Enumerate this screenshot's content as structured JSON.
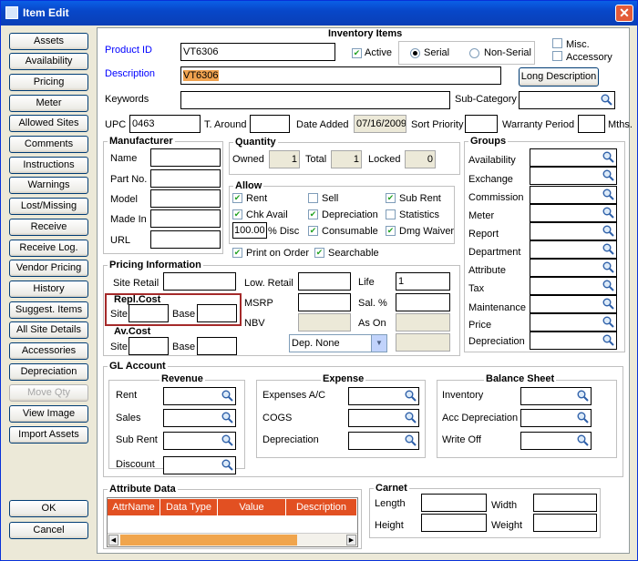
{
  "window": {
    "title": "Item Edit"
  },
  "sidebar": {
    "buttons": [
      "Assets",
      "Availability",
      "Pricing",
      "Meter",
      "Allowed Sites",
      "Comments",
      "Instructions",
      "Warnings",
      "Lost/Missing",
      "Receive",
      "Receive Log.",
      "Vendor Pricing",
      "History",
      "Suggest. Items",
      "All Site Details",
      "Accessories",
      "Depreciation",
      "Move Qty",
      "View Image",
      "Import Assets"
    ],
    "ok": "OK",
    "cancel": "Cancel"
  },
  "inventory": {
    "title": "Inventory Items",
    "product_id_label": "Product ID",
    "product_id": "VT6306",
    "active_label": "Active",
    "serial_label": "Serial",
    "non_serial_label": "Non-Serial",
    "misc_label": "Misc.",
    "accessory_label": "Accessory",
    "description_label": "Description",
    "description": "VT6306",
    "long_description_button": "Long Description",
    "keywords_label": "Keywords",
    "keywords": "",
    "subcategory_label": "Sub-Category",
    "upc_label": "UPC",
    "upc": "0463",
    "turnaround_label": "T. Around",
    "date_added_label": "Date Added",
    "date_added": "07/16/2009",
    "sort_priority_label": "Sort Priority",
    "warranty_label": "Warranty Period",
    "months_label": "Mths."
  },
  "manufacturer": {
    "title": "Manufacturer",
    "labels": [
      "Name",
      "Part No.",
      "Model",
      "Made In",
      "URL"
    ]
  },
  "quantity": {
    "title": "Quantity",
    "owned_label": "Owned",
    "owned": "1",
    "total_label": "Total",
    "total": "1",
    "locked_label": "Locked",
    "locked": "0"
  },
  "allow": {
    "title": "Allow",
    "rent": "Rent",
    "sell": "Sell",
    "sub_rent": "Sub Rent",
    "chk_avail": "Chk Avail",
    "depreciation": "Depreciation",
    "statistics": "Statistics",
    "disc_value": "100.00",
    "disc_label": "% Disc",
    "consumable": "Consumable",
    "dmg_waiver": "Dmg Waiver"
  },
  "print_on_order": "Print on Order",
  "searchable": "Searchable",
  "pricing": {
    "title": "Pricing Information",
    "site_retail": "Site Retail",
    "repl_cost": "Repl.Cost",
    "site": "Site",
    "base": "Base",
    "av_cost": "Av.Cost",
    "low_retail": "Low. Retail",
    "msrp": "MSRP",
    "nbv": "NBV",
    "life_label": "Life",
    "life": "1",
    "sal_label": "Sal. %",
    "as_on_label": "As On",
    "dep_select": "Dep. None"
  },
  "groups": {
    "title": "Groups",
    "labels": [
      "Availability",
      "Exchange",
      "Commission",
      "Meter",
      "Report",
      "Department",
      "Attribute",
      "Tax",
      "Maintenance",
      "Price",
      "Depreciation"
    ]
  },
  "gl": {
    "title": "GL Account",
    "revenue_title": "Revenue",
    "revenue": [
      "Rent",
      "Sales",
      "Sub Rent"
    ],
    "discount": "Discount",
    "expense_title": "Expense",
    "expense": [
      "Expenses A/C",
      "COGS",
      "Depreciation"
    ],
    "balance_title": "Balance Sheet",
    "balance": [
      "Inventory",
      "Acc Depreciation",
      "Write Off"
    ]
  },
  "attribute": {
    "title": "Attribute Data",
    "columns": [
      "AttrName",
      "Data Type",
      "Value",
      "Description"
    ]
  },
  "carnet": {
    "title": "Carnet",
    "length": "Length",
    "width": "Width",
    "height": "Height",
    "weight": "Weight"
  }
}
